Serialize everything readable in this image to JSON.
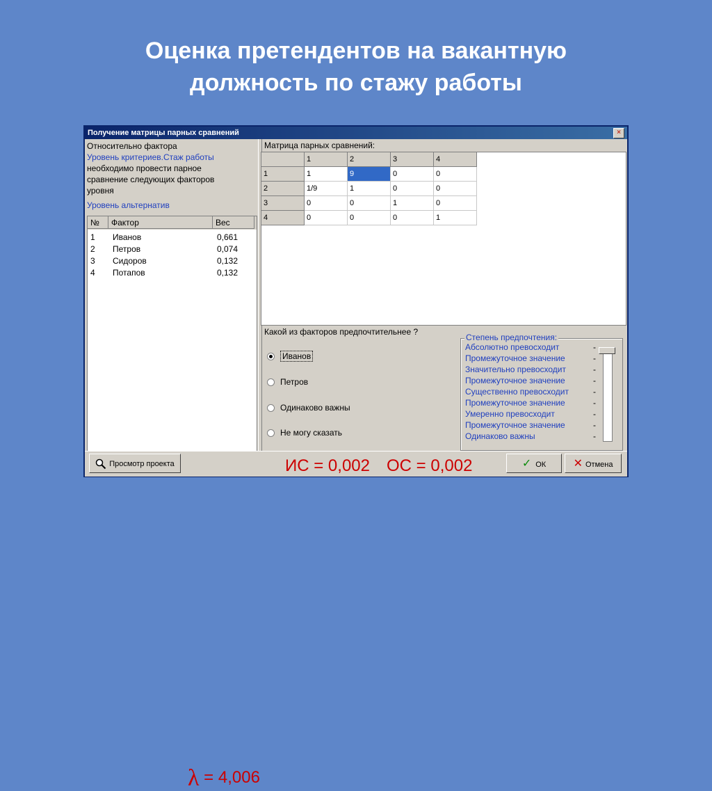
{
  "slide": {
    "title_line1": "Оценка претендентов на вакантную",
    "title_line2": "должность по стажу работы"
  },
  "window": {
    "title": "Получение матрицы парных сравнений",
    "close_glyph": "×"
  },
  "left_panel": {
    "relative_label": "Относительно фактора",
    "criteria_level": "Уровень критериев.Стаж работы",
    "instruction_1": "необходимо провести парное",
    "instruction_2": "сравнение следующих факторов",
    "instruction_3": "уровня",
    "alt_level": "Уровень альтернатив",
    "columns": [
      "№",
      "Фактор",
      "Вес"
    ],
    "rows": [
      {
        "n": "1",
        "name": "Иванов",
        "weight": "0,661"
      },
      {
        "n": "2",
        "name": "Петров",
        "weight": "0,074"
      },
      {
        "n": "3",
        "name": "Сидоров",
        "weight": "0,132"
      },
      {
        "n": "4",
        "name": "Потапов",
        "weight": "0,132"
      }
    ]
  },
  "matrix": {
    "label": "Матрица парных сравнений:",
    "col_headers": [
      "1",
      "2",
      "3",
      "4"
    ],
    "row_headers": [
      "1",
      "2",
      "3",
      "4"
    ],
    "cells": [
      [
        "1",
        "9",
        "0",
        "0"
      ],
      [
        "1/9",
        "1",
        "0",
        "0"
      ],
      [
        "0",
        "0",
        "1",
        "0"
      ],
      [
        "0",
        "0",
        "0",
        "1"
      ]
    ]
  },
  "question": {
    "text": "Какой из факторов предпочтительнее ?",
    "options": [
      "Иванов",
      "Петров",
      "Одинаково важны",
      "Не могу сказать"
    ],
    "selected": "Иванов"
  },
  "preference": {
    "legend": "Степень предпочтения:",
    "items": [
      "Абсолютно превосходит",
      "Промежуточное значение",
      "Значительно превосходит",
      "Промежуточное значение",
      "Существенно превосходит",
      "Промежуточное значение",
      "Умеренно превосходит",
      "Промежуточное значение",
      "Одинаково важны"
    ],
    "tick": "-"
  },
  "bottom": {
    "view_project": "Просмотр проекта",
    "lambda_symbol": "λ",
    "lambda_value": "= 4,006",
    "ic": "ИС = 0,002",
    "oc": "ОС = 0,002",
    "ok": "ОК",
    "cancel": "Отмена"
  },
  "colors": {
    "background": "#5e86c9",
    "title_bar": "#0a246a",
    "highlight": "#3169c6",
    "formula_red": "#cc0000",
    "link_blue": "#1f3fbf"
  }
}
